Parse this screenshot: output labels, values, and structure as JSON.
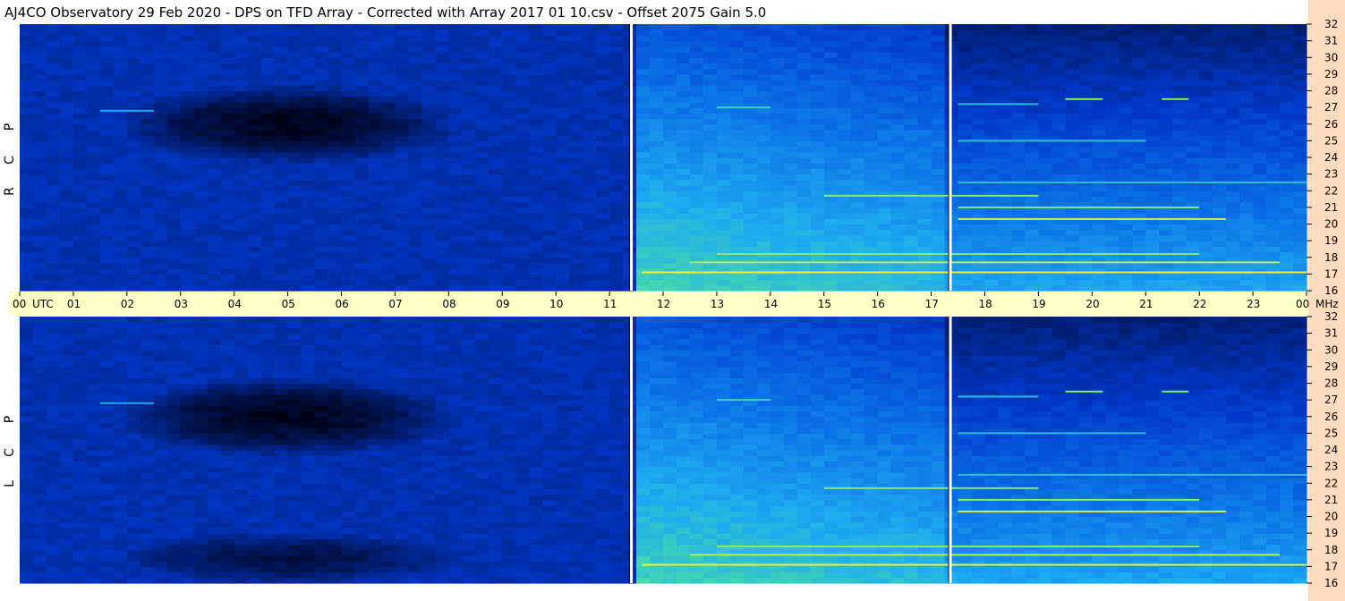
{
  "title": "AJ4CO Observatory  29 Feb 2020  -  DPS on TFD Array  -  Corrected with Array 2017 01 10.csv  -  Offset 2075  Gain 5.0",
  "colors": {
    "background": "#ffffff",
    "time_axis_band": "#ffffc8",
    "freq_axis_band": "#ffdcc0",
    "colormap": [
      "#000010",
      "#001a66",
      "#0037c8",
      "#0a6ee6",
      "#1eaaf0",
      "#46dcaa",
      "#b4f050",
      "#fff032",
      "#ff6400"
    ]
  },
  "chart_data": {
    "type": "heatmap",
    "title": "AJ4CO Observatory  29 Feb 2020  -  DPS on TFD Array  -  Corrected with Array 2017 01 10.csv  -  Offset 2075  Gain 5.0",
    "time_axis": {
      "unit_label": "UTC",
      "range_hours": [
        0,
        24
      ],
      "tick_labels": [
        "00",
        "01",
        "02",
        "03",
        "04",
        "05",
        "06",
        "07",
        "08",
        "09",
        "10",
        "11",
        "12",
        "13",
        "14",
        "15",
        "16",
        "17",
        "18",
        "19",
        "20",
        "21",
        "22",
        "23",
        "00"
      ]
    },
    "freq_axis": {
      "unit_label": "MHz",
      "range_mhz": [
        16,
        32
      ],
      "tick_labels": [
        "32",
        "31",
        "30",
        "29",
        "28",
        "27",
        "26",
        "25",
        "24",
        "23",
        "22",
        "21",
        "20",
        "19",
        "18",
        "17",
        "16"
      ]
    },
    "panels": [
      {
        "name": "RCP",
        "letters": [
          "P",
          "C",
          "R"
        ],
        "freq_range_mhz": [
          16,
          32
        ]
      },
      {
        "name": "LCP",
        "letters": [
          "P",
          "C",
          "L"
        ],
        "freq_range_mhz": [
          16,
          32
        ]
      }
    ],
    "gaps_utc_hours": [
      11.4,
      17.35
    ],
    "segment_intensity_utc": [
      {
        "start": 0,
        "end": 11.4,
        "level": 0.22
      },
      {
        "start": 11.4,
        "end": 17.35,
        "level": 0.5
      },
      {
        "start": 17.35,
        "end": 24,
        "level": 0.36
      }
    ],
    "dark_region": {
      "utc_start": 2.5,
      "utc_end": 7.5,
      "freq_low_mhz": 24,
      "freq_high_mhz": 28
    },
    "interference_lines": [
      {
        "mhz": 17.1,
        "utc_start": 11.6,
        "utc_end": 24,
        "intensity": 0.85
      },
      {
        "mhz": 17.7,
        "utc_start": 12.5,
        "utc_end": 23.5,
        "intensity": 0.75
      },
      {
        "mhz": 18.2,
        "utc_start": 13.0,
        "utc_end": 22.0,
        "intensity": 0.7
      },
      {
        "mhz": 20.3,
        "utc_start": 17.5,
        "utc_end": 22.5,
        "intensity": 0.8
      },
      {
        "mhz": 21.0,
        "utc_start": 17.5,
        "utc_end": 22.0,
        "intensity": 0.7
      },
      {
        "mhz": 21.7,
        "utc_start": 15.0,
        "utc_end": 19.0,
        "intensity": 0.7
      },
      {
        "mhz": 22.5,
        "utc_start": 17.5,
        "utc_end": 24,
        "intensity": 0.55
      },
      {
        "mhz": 25.0,
        "utc_start": 17.5,
        "utc_end": 21.0,
        "intensity": 0.55
      },
      {
        "mhz": 26.8,
        "utc_start": 1.5,
        "utc_end": 2.5,
        "intensity": 0.5
      },
      {
        "mhz": 27.0,
        "utc_start": 13.0,
        "utc_end": 14.0,
        "intensity": 0.6
      },
      {
        "mhz": 27.2,
        "utc_start": 17.5,
        "utc_end": 19.0,
        "intensity": 0.55
      },
      {
        "mhz": 27.5,
        "utc_start": 19.5,
        "utc_end": 20.2,
        "intensity": 0.7
      },
      {
        "mhz": 27.5,
        "utc_start": 21.3,
        "utc_end": 21.8,
        "intensity": 0.7
      }
    ],
    "grid": false
  }
}
